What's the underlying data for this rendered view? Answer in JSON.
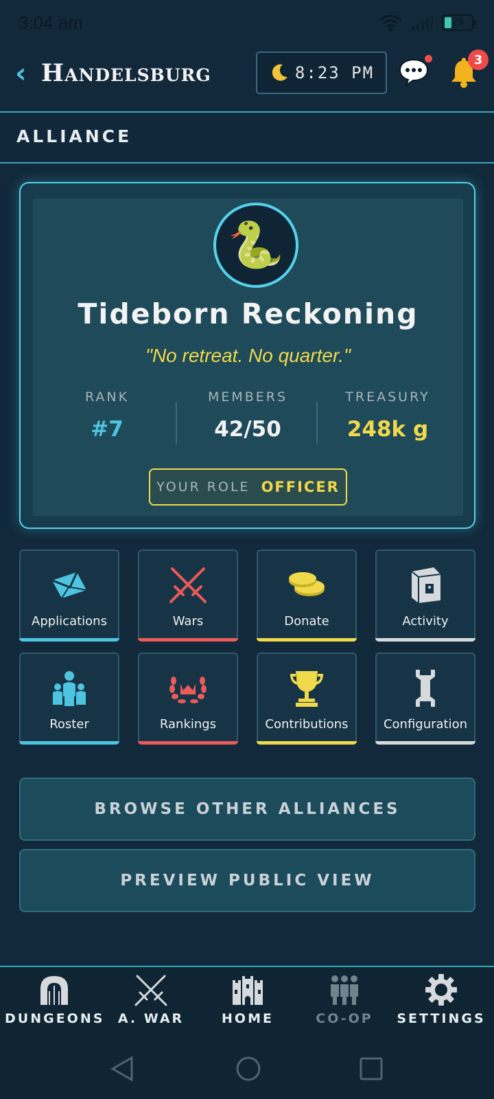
{
  "status_bar": {
    "time": "3:04 am",
    "battery": "29"
  },
  "header": {
    "back_icon": "chevron-left-icon",
    "city": "Handelsburg",
    "clock_icon": "moon-icon",
    "clock_time": "8:23 PM",
    "notification_count": "3"
  },
  "section": {
    "title": "ALLIANCE"
  },
  "alliance": {
    "emblem_icon": "snake-icon",
    "name": "Tideborn Reckoning",
    "motto": "\"No retreat. No quarter.\"",
    "stats": [
      {
        "label": "RANK",
        "value": "#7",
        "color": "#4ec5e0"
      },
      {
        "label": "MEMBERS",
        "value": "42/50",
        "color": "#f3f3f3"
      },
      {
        "label": "TREASURY",
        "value": "248k g",
        "color": "#f0d94a"
      }
    ],
    "role_label": "YOUR ROLE",
    "role_value": "OFFICER"
  },
  "tiles": [
    {
      "label": "Applications",
      "icon": "envelope-icon",
      "accent": "#4ec5e0"
    },
    {
      "label": "Wars",
      "icon": "crossed-swords-icon",
      "accent": "#ec5a5a"
    },
    {
      "label": "Donate",
      "icon": "coins-icon",
      "accent": "#f0d94a"
    },
    {
      "label": "Activity",
      "icon": "book-icon",
      "accent": "#d6dadc"
    },
    {
      "label": "Roster",
      "icon": "group-icon",
      "accent": "#4ec5e0"
    },
    {
      "label": "Rankings",
      "icon": "laurel-crown-icon",
      "accent": "#ec5a5a"
    },
    {
      "label": "Contributions",
      "icon": "trophy-icon",
      "accent": "#f0d94a"
    },
    {
      "label": "Configuration",
      "icon": "wrench-icon",
      "accent": "#d6dadc"
    }
  ],
  "buttons": {
    "browse": "BROWSE OTHER ALLIANCES",
    "preview": "PREVIEW PUBLIC VIEW"
  },
  "nav": [
    {
      "label": "DUNGEONS",
      "icon": "gate-icon"
    },
    {
      "label": "A. WAR",
      "icon": "crossed-swords-icon"
    },
    {
      "label": "HOME",
      "icon": "castle-icon"
    },
    {
      "label": "CO-OP",
      "icon": "people-icon"
    },
    {
      "label": "SETTINGS",
      "icon": "gear-icon"
    }
  ]
}
